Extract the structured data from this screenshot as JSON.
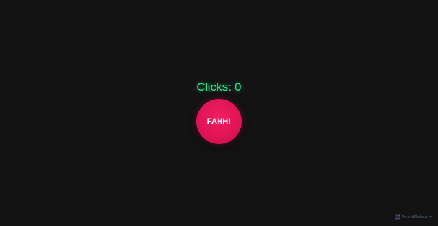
{
  "counter": {
    "label": "Clicks: 0"
  },
  "button": {
    "label": "FAHH!"
  },
  "watermark": {
    "text": "ScanMalware",
    "icon": "scanmalware-logo-icon"
  },
  "colors": {
    "background": "#131313",
    "counter_text": "#2ee88a",
    "button_fill": "#e01457",
    "button_text": "#ffffff",
    "watermark": "#46536a"
  }
}
